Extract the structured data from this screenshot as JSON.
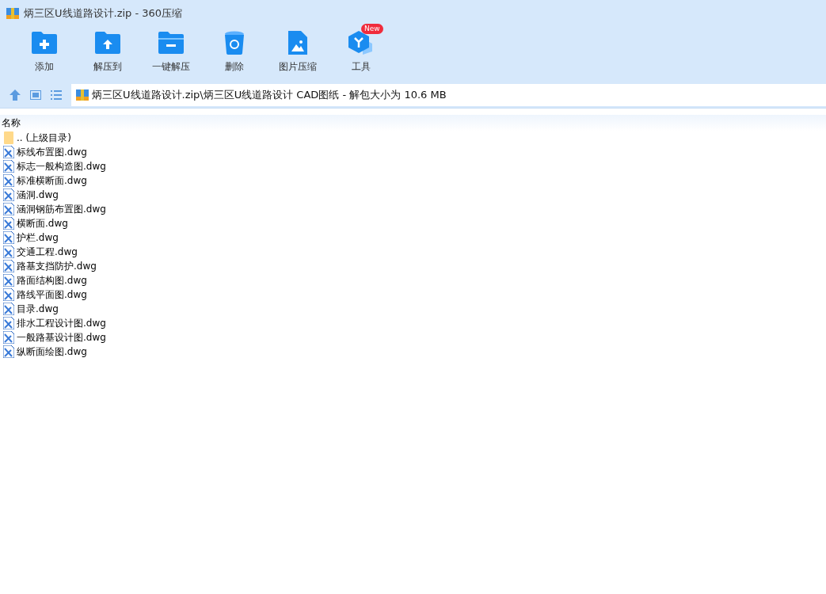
{
  "window": {
    "title": "炳三区U线道路设计.zip - 360压缩"
  },
  "toolbar": [
    {
      "label": "添加",
      "kind": "add"
    },
    {
      "label": "解压到",
      "kind": "extract"
    },
    {
      "label": "一键解压",
      "kind": "oneclick"
    },
    {
      "label": "删除",
      "kind": "delete"
    },
    {
      "label": "图片压缩",
      "kind": "image"
    },
    {
      "label": "工具",
      "kind": "tools",
      "badge": "New"
    }
  ],
  "address_bar": {
    "path": "炳三区U线道路设计.zip\\炳三区U线道路设计 CAD图纸 - 解包大小为 10.6 MB"
  },
  "table": {
    "columns": [
      "名称"
    ],
    "rows": [
      {
        "name": ".. (上级目录)",
        "kind": "folder"
      },
      {
        "name": "标线布置图.dwg",
        "kind": "dwg"
      },
      {
        "name": "标志一般构造图.dwg",
        "kind": "dwg"
      },
      {
        "name": "标准横断面.dwg",
        "kind": "dwg"
      },
      {
        "name": "涵洞.dwg",
        "kind": "dwg"
      },
      {
        "name": "涵洞钢筋布置图.dwg",
        "kind": "dwg"
      },
      {
        "name": "横断面.dwg",
        "kind": "dwg"
      },
      {
        "name": "护栏.dwg",
        "kind": "dwg"
      },
      {
        "name": "交通工程.dwg",
        "kind": "dwg"
      },
      {
        "name": "路基支挡防护.dwg",
        "kind": "dwg"
      },
      {
        "name": "路面结构图.dwg",
        "kind": "dwg"
      },
      {
        "name": "路线平面图.dwg",
        "kind": "dwg"
      },
      {
        "name": "目录.dwg",
        "kind": "dwg"
      },
      {
        "name": "排水工程设计图.dwg",
        "kind": "dwg"
      },
      {
        "name": "一般路基设计图.dwg",
        "kind": "dwg"
      },
      {
        "name": "纵断面绘图.dwg",
        "kind": "dwg"
      }
    ]
  }
}
